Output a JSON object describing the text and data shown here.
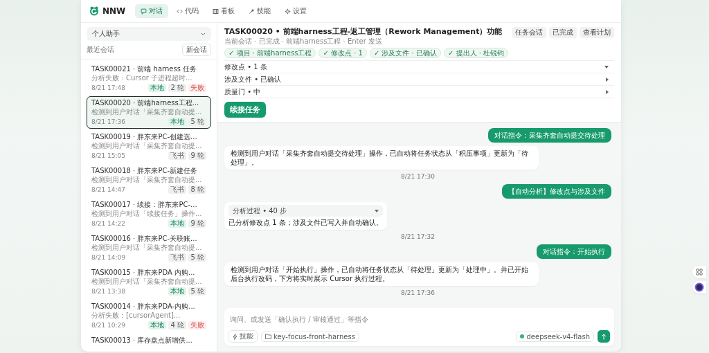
{
  "app": {
    "name": "NNW"
  },
  "nav": {
    "tabs": [
      {
        "label": "对话",
        "kind": "chat",
        "selected": true
      },
      {
        "label": "代码",
        "kind": "code",
        "selected": false
      },
      {
        "label": "看板",
        "kind": "board",
        "selected": false
      },
      {
        "label": "技能",
        "kind": "skill",
        "selected": false
      },
      {
        "label": "设置",
        "kind": "settings",
        "selected": false
      }
    ]
  },
  "sidebar": {
    "assistant": "个人助手",
    "section_label": "最近会话",
    "new_button": "新会话",
    "items": [
      {
        "title": "TASK00021 · 前端 harness 任务",
        "subtitle": "分析失败：Cursor 子进程超时...",
        "time": "8/21 17:48",
        "selected": false,
        "tags": [
          {
            "label": "本地",
            "kind": "local"
          },
          {
            "label": "2 轮",
            "kind": "count"
          },
          {
            "label": "失败",
            "kind": "failed"
          }
        ]
      },
      {
        "title": "TASK00020 · 前端harness工程...",
        "subtitle": "检测到用户对话「采集齐套自动提...",
        "time": "8/21 17:36",
        "selected": true,
        "tags": [
          {
            "label": "本地",
            "kind": "local"
          },
          {
            "label": "5 轮",
            "kind": "count"
          }
        ]
      },
      {
        "title": "TASK00019 · 胖东来PC-创建选...",
        "subtitle": "检测到用户对话「采集齐套自动提...",
        "time": "8/21 15:05",
        "selected": false,
        "tags": [
          {
            "label": "飞书",
            "kind": "feishu"
          },
          {
            "label": "9 轮",
            "kind": "count"
          }
        ]
      },
      {
        "title": "TASK00018 · 胖东来PC-新建任务",
        "subtitle": "检测到用户对话「采集齐套自动提...",
        "time": "8/21 14:47",
        "selected": false,
        "tags": [
          {
            "label": "飞书",
            "kind": "feishu"
          },
          {
            "label": "8 轮",
            "kind": "count"
          }
        ]
      },
      {
        "title": "TASK00017 · 续接：胖东来PC-...",
        "subtitle": "检测到用户对话「续接任务」操作...",
        "time": "8/21 14:22",
        "selected": false,
        "tags": [
          {
            "label": "本地",
            "kind": "local"
          },
          {
            "label": "9 轮",
            "kind": "count"
          }
        ]
      },
      {
        "title": "TASK00016 · 胖东来PC-关联账...",
        "subtitle": "检测到用户对话「采集齐套自动提...",
        "time": "8/21 14:09",
        "selected": false,
        "tags": [
          {
            "label": "飞书",
            "kind": "feishu"
          },
          {
            "label": "5 轮",
            "kind": "count"
          }
        ]
      },
      {
        "title": "TASK00015 · 胖东来PDA 内购...",
        "subtitle": "检测到用户对话「采集齐套自动提...",
        "time": "8/21 13:38",
        "selected": false,
        "tags": [
          {
            "label": "本地",
            "kind": "local"
          },
          {
            "label": "5 轮",
            "kind": "count"
          }
        ]
      },
      {
        "title": "TASK00014 · 胖东来PDA-内购...",
        "subtitle": "分析失败：[cursorAgent]...",
        "time": "8/21 10:29",
        "selected": false,
        "tags": [
          {
            "label": "本地",
            "kind": "local"
          },
          {
            "label": "4 轮",
            "kind": "count"
          },
          {
            "label": "失败",
            "kind": "failed"
          }
        ]
      },
      {
        "title": "TASK00013 · 库存盘点新增供...",
        "selected": false
      }
    ]
  },
  "task": {
    "title": "TASK00020 • 前端harness工程-返工管理（Rework Management）功能",
    "subtitle": "当前会话 · 已完成 · 前端harness工程 · Enter 发送",
    "actions": [
      "任务会话",
      "已完成",
      "查看计划"
    ],
    "chips": [
      "✓ 项目 · 前端harness工程",
      "✓ 修改点 · 1",
      "✓ 涉及文件 · 已确认",
      "✓ 提出人 · 杜锐钧"
    ],
    "sections": [
      {
        "label": "修改点 • 1 条",
        "expanded": true
      },
      {
        "label": "涉及文件 • 已确认",
        "expanded": false
      },
      {
        "label": "质量门 • 中",
        "expanded": false
      }
    ],
    "resume_button": "续接任务"
  },
  "messages": [
    {
      "kind": "user",
      "text": "对话指令：采集齐套自动提交待处理"
    },
    {
      "kind": "bot",
      "text": "检测到用户对话「采集齐套自动提交待处理」操作，已自动将任务状态从「积压事项」更新为「待处理」。"
    },
    {
      "kind": "time",
      "text": "8/21 17:30"
    },
    {
      "kind": "user",
      "text": "【自动分析】修改点与涉及文件"
    },
    {
      "kind": "analysis",
      "summary": "分析过程 • 40 步",
      "text": "已分析修改点 1 条；涉及文件已写入并自动确认。"
    },
    {
      "kind": "time",
      "text": "8/21 17:32"
    },
    {
      "kind": "user",
      "text": "对话指令：开始执行"
    },
    {
      "kind": "bot",
      "text": "检测到用户对话「开始执行」操作，已自动将任务状态从「待处理」更新为「处理中」。并已开始后台执行改码，下方将实时展示 Cursor 执行过程。"
    },
    {
      "kind": "time",
      "text": "8/21 17:36"
    }
  ],
  "composer": {
    "placeholder": "询问、或发送「确认执行 / 审核通过」等指令",
    "skill_button": "技能",
    "workspace": "key-focus-front-harness",
    "model": "deepseek-v4-flash"
  }
}
